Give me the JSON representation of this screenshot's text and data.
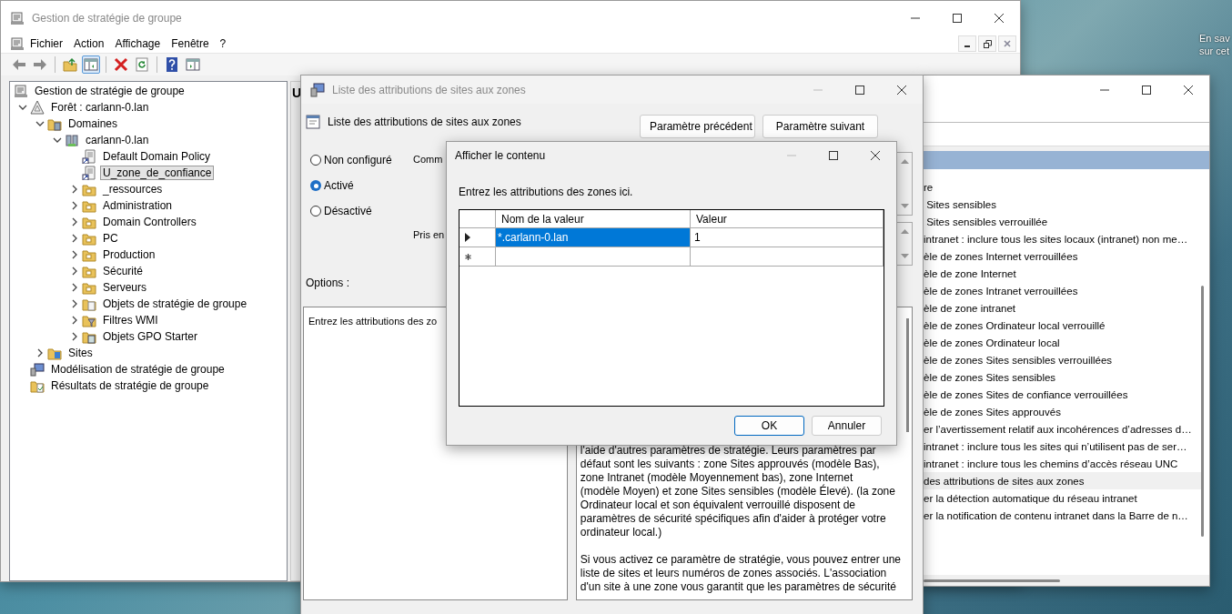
{
  "desktop": {
    "text_lines": [
      "En sav",
      "sur cet"
    ]
  },
  "main_window": {
    "title": "Gestion de stratégie de groupe",
    "menu": [
      "Fichier",
      "Action",
      "Affichage",
      "Fenêtre",
      "?"
    ],
    "toolbar": [
      {
        "kind": "back",
        "on": false
      },
      {
        "kind": "forward",
        "on": false
      },
      {
        "kind": "folder-up",
        "on": false
      },
      {
        "kind": "pane",
        "on": true
      },
      {
        "kind": "delete",
        "on": false
      },
      {
        "kind": "refresh",
        "on": false
      },
      {
        "kind": "help",
        "on": false
      },
      {
        "kind": "console",
        "on": false
      }
    ],
    "tree": [
      {
        "label": "Gestion de stratégie de groupe",
        "kind": "console",
        "selected": false,
        "children": [
          {
            "label": "Forêt : carlann-0.lan",
            "kind": "forest",
            "expanded": true,
            "selected": false,
            "children": [
              {
                "label": "Domaines",
                "kind": "domains",
                "expanded": true,
                "selected": false,
                "children": [
                  {
                    "label": "carlann-0.lan",
                    "kind": "domain",
                    "expanded": true,
                    "selected": false,
                    "children": [
                      {
                        "label": "Default Domain Policy",
                        "kind": "gpo-link",
                        "selected": false
                      },
                      {
                        "label": "U_zone_de_confiance",
                        "kind": "gpo-link",
                        "selected": true
                      },
                      {
                        "label": "_ressources",
                        "kind": "ou",
                        "expanded": false,
                        "selected": false
                      },
                      {
                        "label": "Administration",
                        "kind": "ou",
                        "expanded": false,
                        "selected": false
                      },
                      {
                        "label": "Domain Controllers",
                        "kind": "ou",
                        "expanded": false,
                        "selected": false
                      },
                      {
                        "label": "PC",
                        "kind": "ou",
                        "expanded": false,
                        "selected": false
                      },
                      {
                        "label": "Production",
                        "kind": "ou",
                        "expanded": false,
                        "selected": false
                      },
                      {
                        "label": "Sécurité",
                        "kind": "ou",
                        "expanded": false,
                        "selected": false
                      },
                      {
                        "label": "Serveurs",
                        "kind": "ou",
                        "expanded": false,
                        "selected": false
                      },
                      {
                        "label": "Objets de stratégie de groupe",
                        "kind": "gpo-folder",
                        "expanded": false,
                        "selected": false
                      },
                      {
                        "label": "Filtres WMI",
                        "kind": "filter-folder",
                        "expanded": false,
                        "selected": false
                      },
                      {
                        "label": "Objets GPO Starter",
                        "kind": "starter-folder",
                        "expanded": false,
                        "selected": false
                      }
                    ]
                  }
                ]
              },
              {
                "label": "Sites",
                "kind": "sites",
                "expanded": false,
                "selected": false
              }
            ]
          },
          {
            "label": "Modélisation de stratégie de groupe",
            "kind": "modeling",
            "selected": false
          },
          {
            "label": "Résultats de stratégie de groupe",
            "kind": "results",
            "selected": false
          }
        ]
      }
    ],
    "right_pane_heading": "U"
  },
  "editor_window": {
    "settings": [
      {
        "label": "re",
        "selected": false
      },
      {
        "label": " Sites sensibles",
        "selected": false
      },
      {
        "label": " Sites sensibles verrouillée",
        "selected": false
      },
      {
        "label": "intranet : inclure tous les sites locaux (intranet) non me…",
        "selected": false
      },
      {
        "label": "èle de zones Internet verrouillées",
        "selected": false
      },
      {
        "label": "èle de zone Internet",
        "selected": false
      },
      {
        "label": "èle de zones Intranet verrouillées",
        "selected": false
      },
      {
        "label": "èle de zone intranet",
        "selected": false
      },
      {
        "label": "èle de zones Ordinateur local verrouillé",
        "selected": false
      },
      {
        "label": "èle de zones Ordinateur local",
        "selected": false
      },
      {
        "label": "èle de zones Sites sensibles verrouillées",
        "selected": false
      },
      {
        "label": "èle de zones Sites sensibles",
        "selected": false
      },
      {
        "label": "èle de zones Sites de confiance verrouillées",
        "selected": false
      },
      {
        "label": "èle de zones Sites approuvés",
        "selected": false
      },
      {
        "label": "er l’avertissement relatif aux incohérences d’adresses d…",
        "selected": false
      },
      {
        "label": "intranet : inclure tous les sites qui n’utilisent pas de ser…",
        "selected": false
      },
      {
        "label": "intranet : inclure tous les chemins d’accès réseau UNC",
        "selected": false
      },
      {
        "label": "des attributions de sites aux zones",
        "selected": true
      },
      {
        "label": "er la détection automatique du réseau intranet",
        "selected": false
      },
      {
        "label": "er la notification de contenu intranet dans la Barre de n…",
        "selected": false
      }
    ]
  },
  "policy_window": {
    "title": "Liste des attributions de sites aux zones",
    "setting_title": "Liste des attributions de sites aux zones",
    "buttons": [
      "Paramètre précédent",
      "Paramètre suivant"
    ],
    "options": [
      {
        "label": "Non configuré",
        "selected": false
      },
      {
        "label": "Activé",
        "selected": true
      },
      {
        "label": "Désactivé",
        "selected": false
      }
    ],
    "comment_label": "Comm",
    "supported_label": "Pris en",
    "options_label": "Options :",
    "options_text": "Entrez les attributions des zo",
    "help_paragraphs": [
      [
        "l'aide d'autres paramètres de stratégie. Leurs paramètres par",
        "défaut sont les suivants : zone Sites approuvés (modèle Bas),",
        "zone Intranet (modèle Moyennement bas), zone Internet",
        "(modèle Moyen) et zone Sites sensibles (modèle Élevé). (la zone",
        "Ordinateur local et son équivalent verrouillé disposent de",
        "paramètres de sécurité spécifiques afin d'aider à protéger votre",
        "ordinateur local.)"
      ],
      [
        "Si vous activez ce paramètre de stratégie, vous pouvez entrer une",
        "liste de sites et leurs numéros de zones associés. L'association",
        "d'un site à une zone vous garantit que les paramètres de sécurité"
      ]
    ]
  },
  "dialog": {
    "title": "Afficher le contenu",
    "prompt": "Entrez les attributions des zones ici.",
    "columns": [
      "Nom de la valeur",
      "Valeur"
    ],
    "rows": [
      {
        "kind": "current",
        "name": "*.carlann-0.lan",
        "value": "1",
        "selected": true
      },
      {
        "kind": "new",
        "selected": false
      }
    ],
    "buttons": [
      {
        "label": "OK",
        "kind": "default"
      },
      {
        "label": "Annuler",
        "kind": "normal"
      }
    ]
  }
}
